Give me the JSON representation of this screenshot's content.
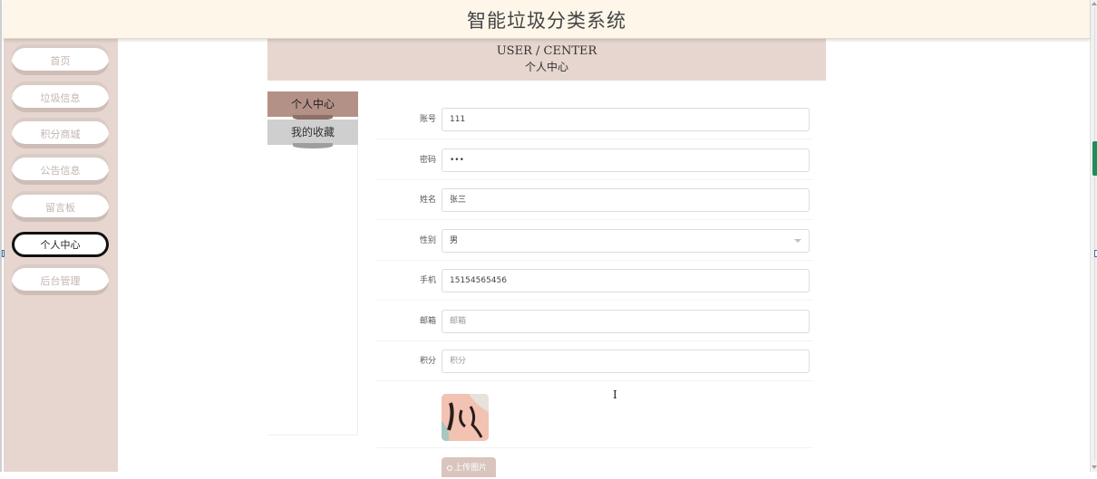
{
  "header": {
    "title": "智能垃圾分类系统"
  },
  "sidebar": {
    "items": [
      {
        "label": "首页"
      },
      {
        "label": "垃圾信息"
      },
      {
        "label": "积分商城"
      },
      {
        "label": "公告信息"
      },
      {
        "label": "留言板"
      },
      {
        "label": "个人中心"
      },
      {
        "label": "后台管理"
      }
    ],
    "active": "个人中心"
  },
  "banner": {
    "en": "USER / CENTER",
    "cn": "个人中心"
  },
  "left_menu": {
    "tabs": [
      {
        "label": "个人中心"
      },
      {
        "label": "我的收藏"
      }
    ]
  },
  "form": {
    "fields": [
      {
        "label": "账号",
        "value": "111",
        "placeholder": ""
      },
      {
        "label": "密码",
        "value": "•••",
        "placeholder": ""
      },
      {
        "label": "姓名",
        "value": "张三",
        "placeholder": ""
      },
      {
        "label": "性别",
        "value": "男",
        "placeholder": ""
      },
      {
        "label": "手机",
        "value": "15154565456",
        "placeholder": ""
      },
      {
        "label": "邮箱",
        "value": "",
        "placeholder": "邮箱"
      },
      {
        "label": "积分",
        "value": "",
        "placeholder": "积分"
      }
    ],
    "upload_label": "上传图片"
  },
  "colors": {
    "header_bg": "#fdf6e9",
    "sidebar_bg": "#e6d6cf",
    "menu_active": "#b49187",
    "menu_inactive": "#cfcfcf",
    "scroll_thumb": "#1f8d5b"
  }
}
